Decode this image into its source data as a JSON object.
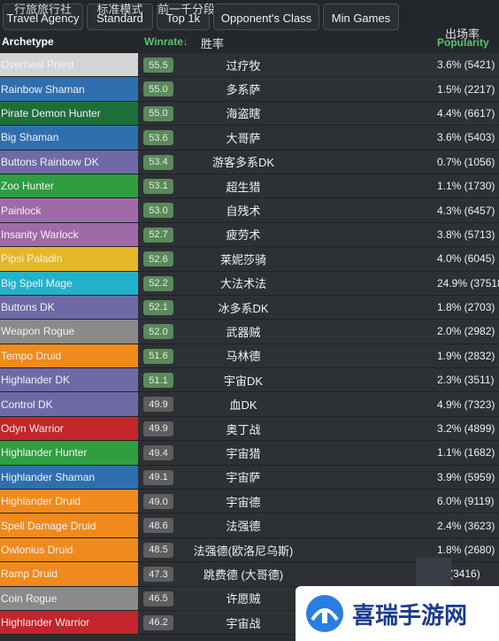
{
  "tabs": [
    {
      "cn": "行旅旅行社",
      "en": "Travel Agency"
    },
    {
      "cn": "标准模式",
      "en": "Standard"
    },
    {
      "cn": "前一千分段",
      "en": "Top 1k"
    },
    {
      "cn": "",
      "en": "Opponent's Class"
    },
    {
      "cn": "",
      "en": "Min Games"
    }
  ],
  "header": {
    "archetype": "Archetype",
    "winrate": "Winrate↓",
    "winrate_cn": "胜率",
    "popularity": "Popularity",
    "popularity_cn": "出场率"
  },
  "rows": [
    {
      "archetype": "Overheal Priest",
      "color": "#d4d4d4",
      "winrate": "55.5",
      "cn": "过疗牧",
      "popularity": "3.6% (5421)"
    },
    {
      "archetype": "Rainbow Shaman",
      "color": "#2f6fb0",
      "winrate": "55.0",
      "cn": "多系萨",
      "popularity": "1.5% (2217)"
    },
    {
      "archetype": "Pirate Demon Hunter",
      "color": "#1e6e3a",
      "winrate": "55.0",
      "cn": "海盗瞎",
      "popularity": "4.4% (6617)"
    },
    {
      "archetype": "Big Shaman",
      "color": "#2f6fb0",
      "winrate": "53.6",
      "cn": "大哥萨",
      "popularity": "3.6% (5403)"
    },
    {
      "archetype": "Buttons Rainbow DK",
      "color": "#6f6aa6",
      "winrate": "53.4",
      "cn": "游客多系DK",
      "popularity": "0.7% (1056)"
    },
    {
      "archetype": "Zoo Hunter",
      "color": "#2f9e40",
      "winrate": "53.1",
      "cn": "超生猎",
      "popularity": "1.1% (1730)"
    },
    {
      "archetype": "Painlock",
      "color": "#a06aa8",
      "winrate": "53.0",
      "cn": "自残术",
      "popularity": "4.3% (6457)"
    },
    {
      "archetype": "Insanity Warlock",
      "color": "#a06aa8",
      "winrate": "52.7",
      "cn": "疲劳术",
      "popularity": "3.8% (5713)"
    },
    {
      "archetype": "Pipsi Paladin",
      "color": "#e6b629",
      "winrate": "52.6",
      "cn": "莱妮莎骑",
      "popularity": "4.0% (6045)"
    },
    {
      "archetype": "Big Spell Mage",
      "color": "#22b2cc",
      "winrate": "52.2",
      "cn": "大法术法",
      "popularity": "24.9% (37518)"
    },
    {
      "archetype": "Buttons DK",
      "color": "#6f6aa6",
      "winrate": "52.1",
      "cn": "冰多系DK",
      "popularity": "1.8% (2703)"
    },
    {
      "archetype": "Weapon Rogue",
      "color": "#8a8a8a",
      "winrate": "52.0",
      "cn": "武器贼",
      "popularity": "2.0% (2982)"
    },
    {
      "archetype": "Tempo Druid",
      "color": "#f08a1c",
      "winrate": "51.6",
      "cn": "马林德",
      "popularity": "1.9% (2832)"
    },
    {
      "archetype": "Highlander DK",
      "color": "#6f6aa6",
      "winrate": "51.1",
      "cn": "宇宙DK",
      "popularity": "2.3% (3511)"
    },
    {
      "archetype": "Control DK",
      "color": "#6f6aa6",
      "winrate": "49.9",
      "cn": "血DK",
      "popularity": "4.9% (7323)"
    },
    {
      "archetype": "Odyn Warrior",
      "color": "#c2252a",
      "winrate": "49.9",
      "cn": "奥丁战",
      "popularity": "3.2% (4899)"
    },
    {
      "archetype": "Highlander Hunter",
      "color": "#2f9e40",
      "winrate": "49.4",
      "cn": "宇宙猎",
      "popularity": "1.1% (1682)"
    },
    {
      "archetype": "Highlander Shaman",
      "color": "#2f6fb0",
      "winrate": "49.1",
      "cn": "宇宙萨",
      "popularity": "3.9% (5959)"
    },
    {
      "archetype": "Highlander Druid",
      "color": "#f08a1c",
      "winrate": "49.0",
      "cn": "宇宙德",
      "popularity": "6.0% (9119)"
    },
    {
      "archetype": "Spell Damage Druid",
      "color": "#f08a1c",
      "winrate": "48.6",
      "cn": "法强德",
      "popularity": "2.4% (3623)"
    },
    {
      "archetype": "Owlonius Druid",
      "color": "#f08a1c",
      "winrate": "48.5",
      "cn": "法强德(欧洛尼乌斯)",
      "popularity": "1.8% (2680)"
    },
    {
      "archetype": "Ramp Druid",
      "color": "#f08a1c",
      "winrate": "47.3",
      "cn": "跳费德 (大哥德)",
      "popularity": "% (3416)"
    },
    {
      "archetype": "Coin Rogue",
      "color": "#8a8a8a",
      "winrate": "46.5",
      "cn": "许愿贼",
      "popularity": ""
    },
    {
      "archetype": "Highlander Warrior",
      "color": "#c2252a",
      "winrate": "46.2",
      "cn": "宇宙战",
      "popularity": ""
    }
  ],
  "watermark": {
    "text": "喜瑞手游网"
  }
}
